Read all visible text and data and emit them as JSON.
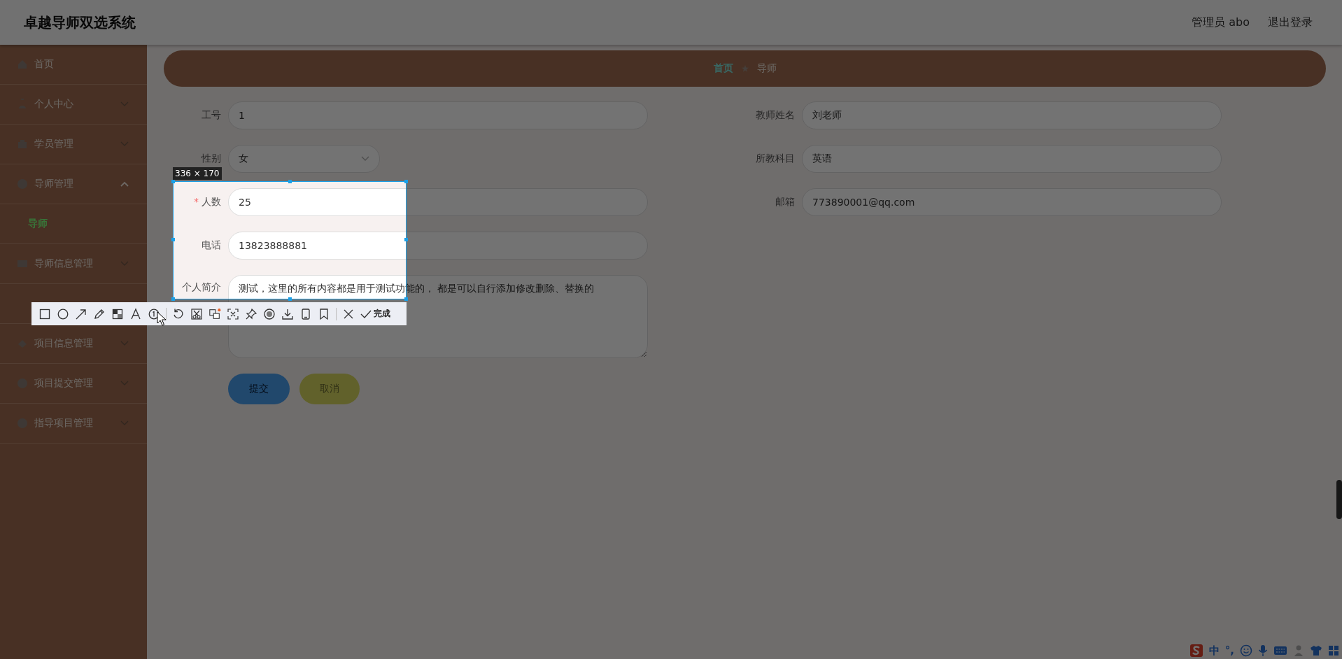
{
  "header": {
    "title": "卓越导师双选系统",
    "user": "管理员 abo",
    "logout": "退出登录"
  },
  "sidebar": {
    "items": [
      {
        "label": "首页",
        "kind": "link"
      },
      {
        "label": "个人中心",
        "kind": "menu",
        "expanded": false
      },
      {
        "label": "学员管理",
        "kind": "menu",
        "expanded": false
      },
      {
        "label": "导师管理",
        "kind": "menu",
        "expanded": true,
        "children": [
          {
            "label": "导师",
            "selected": true
          }
        ]
      },
      {
        "label": "导师信息管理",
        "kind": "menu",
        "expanded": false
      },
      {
        "kind": "menu"
      },
      {
        "label": "项目信息管理",
        "kind": "menu",
        "expanded": false
      },
      {
        "label": "项目提交管理",
        "kind": "menu",
        "expanded": false
      },
      {
        "label": "指导项目管理",
        "kind": "menu",
        "expanded": false
      }
    ]
  },
  "breadcrumb": [
    {
      "label": "首页",
      "current": false
    },
    {
      "label": "导师",
      "current": true
    }
  ],
  "form": {
    "left_fields": [
      {
        "label": "工号",
        "kind": "input",
        "value": "1"
      },
      {
        "label": "性别",
        "kind": "select",
        "value": "女"
      },
      {
        "label": "人数",
        "kind": "input",
        "value": "25",
        "required_mark": "*"
      },
      {
        "label": "电话",
        "kind": "input",
        "value": "13823888881"
      },
      {
        "label": "个人简介",
        "kind": "textarea",
        "value": "测试，这里的所有内容都是用于测试功能的， 都是可以自行添加修改删除、替换的"
      }
    ],
    "right_fields": [
      {
        "label": "教师姓名",
        "kind": "input",
        "value": "刘老师"
      },
      {
        "label": "所教科目",
        "kind": "input",
        "value": "英语"
      },
      {
        "label": "邮箱",
        "kind": "input",
        "value": "773890001@qq.com"
      }
    ],
    "buttons": [
      {
        "label": "提交",
        "kind": "primary"
      },
      {
        "label": "取消",
        "kind": "secondary"
      }
    ]
  },
  "capture": {
    "size": "336 × 170",
    "done_label": "完成"
  },
  "ime": {
    "mode": "中",
    "punctuation": "°,"
  }
}
